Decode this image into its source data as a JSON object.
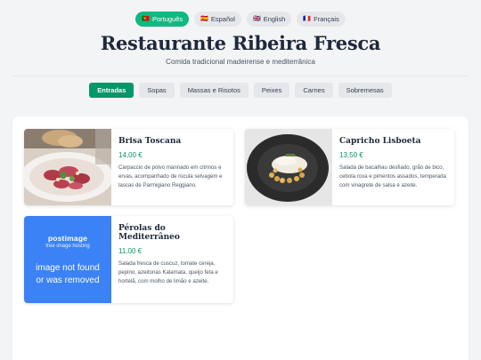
{
  "languages": [
    {
      "flag": "🇵🇹",
      "label": "Português",
      "active": true
    },
    {
      "flag": "🇪🇸",
      "label": "Español",
      "active": false
    },
    {
      "flag": "🇬🇧",
      "label": "English",
      "active": false
    },
    {
      "flag": "🇫🇷",
      "label": "Français",
      "active": false
    }
  ],
  "header": {
    "title": "Restaurante Ribeira Fresca",
    "subtitle": "Comida tradicional madeirense e mediterrânica"
  },
  "categories": [
    {
      "label": "Entradas",
      "active": true
    },
    {
      "label": "Sopas",
      "active": false
    },
    {
      "label": "Massas e Risotos",
      "active": false
    },
    {
      "label": "Peixes",
      "active": false
    },
    {
      "label": "Carnes",
      "active": false
    },
    {
      "label": "Sobremesas",
      "active": false
    }
  ],
  "dishes": [
    {
      "name": "Brisa Toscana",
      "price": "14,00 €",
      "description": "Carpaccio de polvo marinado em citrinos e ervas, acompanhado de rúcula selvagem e lascas de Parmigiano Reggiano."
    },
    {
      "name": "Capricho Lisboeta",
      "price": "13,50 €",
      "description": "Salada de bacalhau desfiado, grão de bico, cebola roxa e pimentos assados, temperada com vinagrete de salsa e azeite."
    },
    {
      "name": "Pérolas do Mediterrâneo",
      "price": "11,00 €",
      "description": "Salada fresca de cuscuz, tomate cereja, pepino, azeitonas Kalamata, queijo feta e hortelã, com molho de limão e azeite."
    }
  ],
  "image_placeholder": {
    "brand": "postimage",
    "tagline": "free image hosting",
    "message_line1": "image not found",
    "message_line2": "or was removed"
  },
  "colors": {
    "accent": "#10b981",
    "category_active": "#059669",
    "price": "#059669",
    "placeholder_bg": "#3b82f6"
  }
}
